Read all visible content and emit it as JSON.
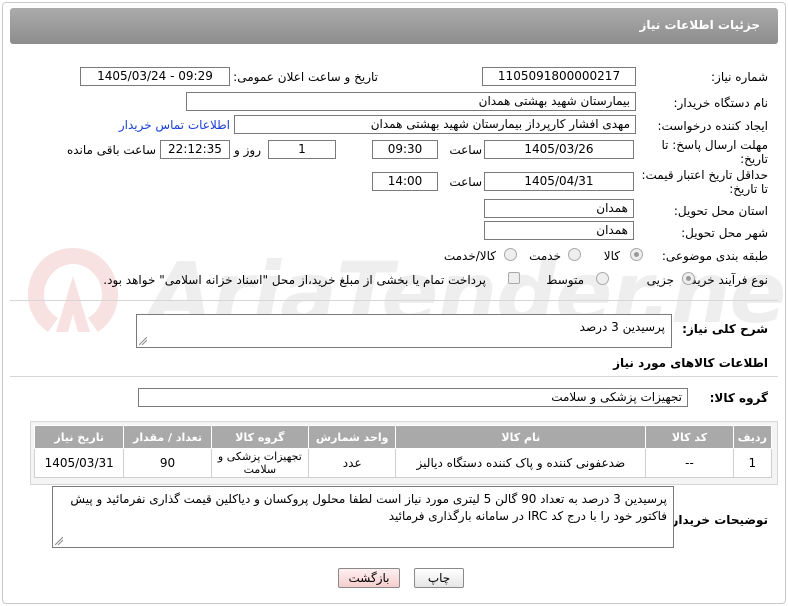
{
  "header": {
    "title": "جزئیات اطلاعات نیاز"
  },
  "watermark": {
    "text": "AriaTender.neT"
  },
  "form": {
    "need_number_label": "شماره نیاز:",
    "need_number": "1105091800000217",
    "announce_label": "تاریخ و ساعت اعلان عمومی:",
    "announce_value": "1405/03/24 - 09:29",
    "buyer_org_label": "نام دستگاه خریدار:",
    "buyer_org": "بیمارستان شهید بهشتی همدان",
    "creator_label": "ایجاد کننده درخواست:",
    "creator": "مهدی افشار کارپرداز بیمارستان شهید بهشتی همدان",
    "contact_link": "اطلاعات تماس خریدار",
    "reply_label_1": "مهلت ارسال پاسخ: تا",
    "reply_label_2": "تاریخ:",
    "reply_date": "1405/03/26",
    "time_label": "ساعت",
    "reply_time": "09:30",
    "days_value": "1",
    "days_label": "روز و",
    "remaining_time": "22:12:35",
    "remaining_label": "ساعت باقی مانده",
    "price_label_1": "حداقل تاریخ اعتبار قیمت:",
    "price_label_2": "تا تاریخ:",
    "price_date": "1405/04/31",
    "price_time": "14:00",
    "province_label": "استان محل تحویل:",
    "province": "همدان",
    "city_label": "شهر محل تحویل:",
    "city": "همدان",
    "category_label": "طبقه بندی موضوعی:",
    "category_options": [
      "کالا",
      "خدمت",
      "کالا/خدمت"
    ],
    "process_label": "نوع فرآیند خرید :",
    "process_options": [
      "جزیی",
      "متوسط"
    ],
    "payment_text": "پرداخت تمام یا بخشی از مبلغ خرید،از محل \"اسناد خزانه اسلامی\" خواهد بود."
  },
  "description": {
    "label": "شرح کلی نیاز:",
    "value": "پرسیدین 3 درصد"
  },
  "goods": {
    "section_title": "اطلاعات کالاهای مورد نیاز",
    "group_label": "گروه کالا:",
    "group_value": "تجهیزات پزشکی و سلامت",
    "columns": [
      "ردیف",
      "کد کالا",
      "نام کالا",
      "واحد شمارش",
      "گروه کالا",
      "تعداد / مقدار",
      "تاریخ نیاز"
    ],
    "rows": [
      [
        "1",
        "--",
        "ضدعفونی کننده و پاک کننده دستگاه دیالیز",
        "عدد",
        "تجهیزات پزشکی و سلامت",
        "90",
        "1405/03/31"
      ]
    ]
  },
  "buyer_notes": {
    "label": "توضیحات خریدار:",
    "value": "پرسیدین 3 درصد به تعداد 90 گالن 5 لیتری مورد نیاز است لطفا محلول پروکسان و دیاکلین قیمت گذاری نفرمائید و پیش فاکتور خود را با درج کد IRC در سامانه بارگذاری فرمائید"
  },
  "buttons": {
    "print": "چاپ",
    "back": "بازگشت"
  }
}
